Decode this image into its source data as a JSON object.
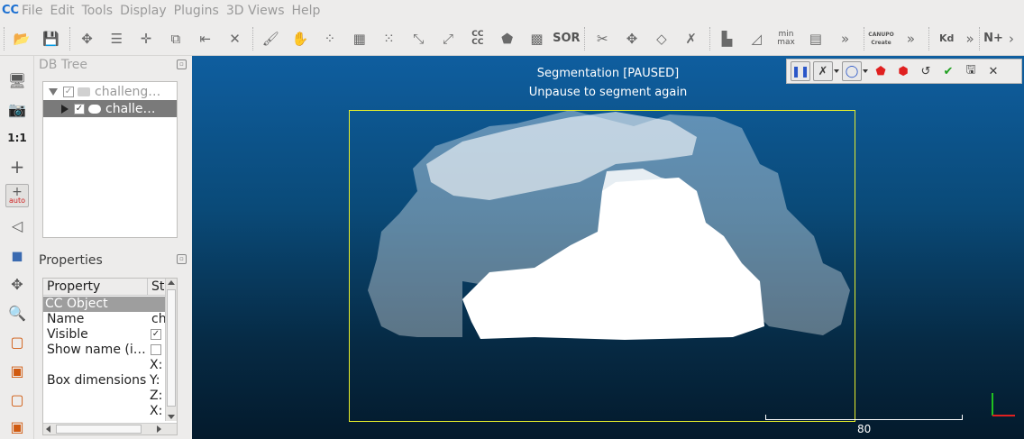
{
  "app": {
    "icon_text": "CC"
  },
  "menu": [
    "File",
    "Edit",
    "Tools",
    "Display",
    "Plugins",
    "3D Views",
    "Help"
  ],
  "toolbar": {
    "cc_text": "CC\nCC",
    "sor_text": "SOR",
    "minmax_text": "min\nmax",
    "canupo_text": "CANUPO\nCreate",
    "kd_text": "Kd",
    "overflow_1": "»",
    "overflow_2": "»",
    "nplus_text": "N+",
    "overflow_3": "»"
  },
  "left_tools": {
    "zoom_label": "1:1",
    "auto_label": "auto"
  },
  "db_tree": {
    "title": "DB Tree",
    "items": [
      {
        "label": "challeng…",
        "checked": true
      },
      {
        "label": "challe…",
        "checked": true
      }
    ]
  },
  "properties": {
    "title": "Properties",
    "headers": [
      "Property",
      "Sta"
    ],
    "section": "CC Object",
    "rows": [
      {
        "name": "Name",
        "value": "ch"
      },
      {
        "name": "Visible",
        "value": "✓"
      },
      {
        "name": "Show name (i…",
        "value": ""
      },
      {
        "name": "Box dimensions",
        "values": [
          "X:",
          "Y:",
          "Z:",
          "X:"
        ]
      }
    ]
  },
  "view": {
    "status_line1": "Segmentation [PAUSED]",
    "status_line2": "Unpause to segment again",
    "scale_value": "80",
    "colors": {
      "segment_rect": "#e6ee2c",
      "points": "#ffffff",
      "axis_x": "#e02020",
      "axis_y": "#20c020"
    }
  },
  "segmentation_toolbar": {
    "buttons": [
      "pause-icon",
      "polyline-icon",
      "lasso-icon",
      "segment-in-icon",
      "segment-out-icon",
      "reset-icon",
      "confirm-icon",
      "export-icon",
      "cancel-icon"
    ]
  }
}
